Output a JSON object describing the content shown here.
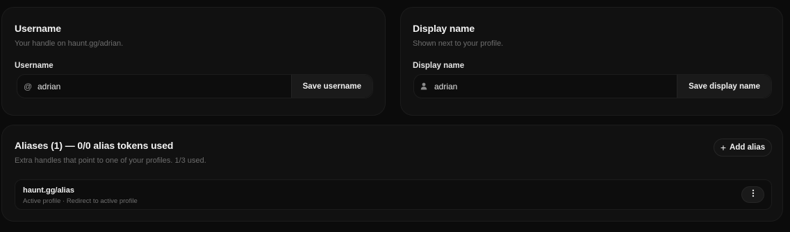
{
  "username_card": {
    "title": "Username",
    "description": "Your handle on haunt.gg/adrian.",
    "field_label": "Username",
    "prefix": "@",
    "value": "adrian",
    "button_label": "Save username"
  },
  "display_card": {
    "title": "Display name",
    "description": "Shown next to your profile.",
    "field_label": "Display name",
    "prefix_icon": "user-icon",
    "value": "adrian",
    "button_label": "Save display name"
  },
  "aliases_card": {
    "title": "Aliases (1) — 0/0 alias tokens used",
    "description": "Extra handles that point to one of your profiles. 1/3 used.",
    "add_button": {
      "icon": "plus-icon",
      "label": "Add alias"
    },
    "items": [
      {
        "name": "haunt.gg/alias",
        "subtitle": "Active profile · Redirect to active profile",
        "menu_icon": "kebab-menu-icon"
      }
    ]
  },
  "colors": {
    "background": "#0b0b0b",
    "card": "#111111",
    "border": "#1c1c1c",
    "muted_text": "#6d6d6d",
    "text": "#f2f2f2"
  }
}
